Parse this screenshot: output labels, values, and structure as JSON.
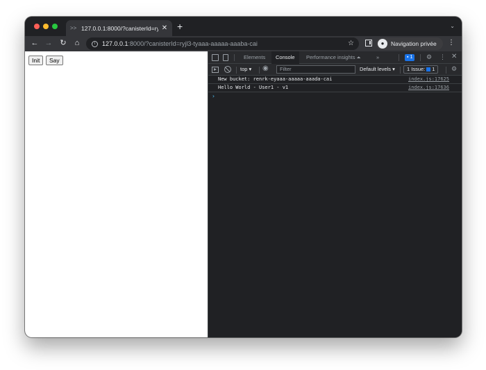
{
  "browser": {
    "tab_title": "127.0.0.1:8000/?canisterId=ryjl",
    "tab_favicon": ">>",
    "tab_close": "✕",
    "new_tab": "+",
    "tab_menu": "⌄",
    "url_host": "127.0.0.1",
    "url_rest": ":8000/?canisterId=ryjl3-tyaaa-aaaaa-aaaba-cai",
    "profile_label": "Navigation privée",
    "nav_back": "←",
    "nav_forward": "→",
    "nav_reload": "↻",
    "nav_home": "⌂",
    "star": "☆",
    "menu": "⋮"
  },
  "page": {
    "init_label": "Init",
    "say_label": "Say"
  },
  "devtools": {
    "tabs": {
      "elements": "Elements",
      "console": "Console",
      "performance": "Performance insights ⏶",
      "more": "»"
    },
    "badge_count": "1",
    "context": "top ▾",
    "filter_placeholder": "Filter",
    "levels": "Default levels ▾",
    "issues_label": "1 Issue:",
    "issues_count": "1",
    "console_rows": [
      {
        "message": "New bucket: renrk-eyaaa-aaaaa-aaada-cai",
        "source": "index.js:17625"
      },
      {
        "message": "Hello World - User1 - v1",
        "source": "index.js:17636"
      }
    ],
    "prompt": "›"
  },
  "colors": {
    "devtools_bg": "#202124",
    "toolbar_bg": "#35363a",
    "accent": "#1a73e8"
  }
}
